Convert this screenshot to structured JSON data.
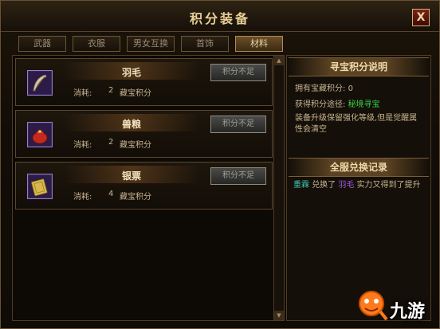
{
  "window": {
    "title": "积分装备",
    "close_label": "X"
  },
  "tabs": [
    {
      "label": "武器",
      "active": false
    },
    {
      "label": "衣服",
      "active": false
    },
    {
      "label": "男女互换",
      "active": false
    },
    {
      "label": "首饰",
      "active": false
    },
    {
      "label": "材料",
      "active": true
    }
  ],
  "items": [
    {
      "name": "羽毛",
      "cost_label": "消耗:",
      "cost_value": "2",
      "cost_unit": "藏宝积分",
      "button_label": "积分不足",
      "icon": "feather-icon"
    },
    {
      "name": "兽粮",
      "cost_label": "消耗:",
      "cost_value": "2",
      "cost_unit": "藏宝积分",
      "button_label": "积分不足",
      "icon": "food-bag-icon"
    },
    {
      "name": "银票",
      "cost_label": "消耗:",
      "cost_value": "4",
      "cost_unit": "藏宝积分",
      "button_label": "积分不足",
      "icon": "banknote-icon"
    }
  ],
  "info": {
    "header": "寻宝积分说明",
    "owned_label": "拥有宝藏积分:",
    "owned_value": "0",
    "source_label": "获得积分途径:",
    "source_value": "秘境寻宝",
    "note": "装备升级保留强化等级,但是觉醒属性会清空"
  },
  "records": {
    "header": "全服兑换记录",
    "entries": [
      {
        "player": "重霖",
        "action": "兑换了",
        "item": "羽毛",
        "result": "实力又得到了提升"
      }
    ]
  },
  "watermark": {
    "text": "九游"
  },
  "colors": {
    "accent_gold": "#e8cf95",
    "green": "#39d24a",
    "teal": "#3fc5b2",
    "purple": "#a15ae0"
  }
}
